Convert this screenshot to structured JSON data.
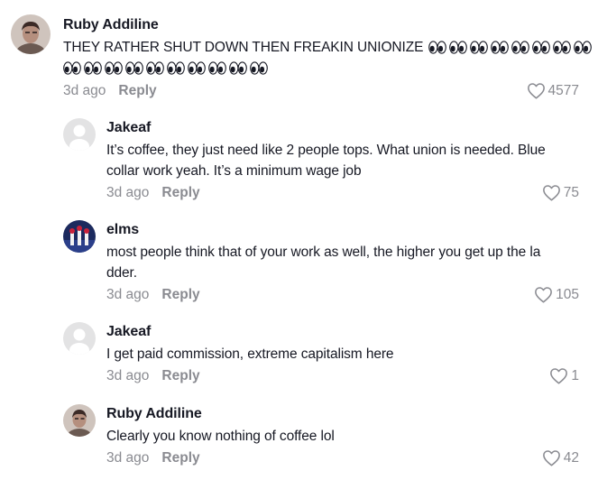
{
  "comments": [
    {
      "username": "Ruby Addiline",
      "text_line1": "THEY RATHER SHUT DOWN THEN FREAKIN UNIONIZE",
      "emoji_row1_count": 8,
      "emoji_row2_count": 10,
      "time": "3d ago",
      "reply": "Reply",
      "likes": "4577"
    },
    {
      "username": "Jakeaf",
      "line1": "It’s coffee, they just need like 2 people tops. What union is needed. Blue",
      "line2": "collar work yeah. It’s a minimum wage job",
      "time": "3d ago",
      "reply": "Reply",
      "likes": "75"
    },
    {
      "username": "elms",
      "line1": "most people think that of your work as well, the higher you get up the la",
      "line2": "dder.",
      "time": "3d ago",
      "reply": "Reply",
      "likes": "105"
    },
    {
      "username": "Jakeaf",
      "line1": "I get paid commission, extreme capitalism here",
      "time": "3d ago",
      "reply": "Reply",
      "likes": "1"
    },
    {
      "username": "Ruby Addiline",
      "line1": "Clearly you know nothing of coffee lol",
      "time": "3d ago",
      "reply": "Reply",
      "likes": "42"
    }
  ],
  "icons": {
    "heart": "heart-icon",
    "eyes": "eyes-emoji-icon",
    "default_avatar": "default-avatar-icon"
  },
  "colors": {
    "text": "#161823",
    "muted": "#8a8b91",
    "avatar_placeholder": "#e3e3e4"
  }
}
